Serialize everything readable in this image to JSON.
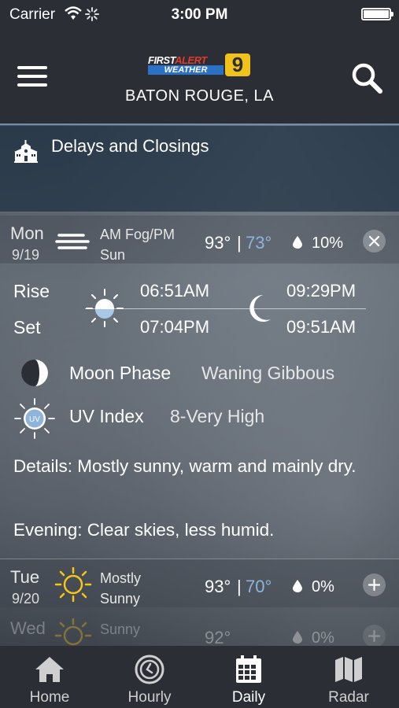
{
  "status_bar": {
    "carrier": "Carrier",
    "time": "3:00 PM"
  },
  "header": {
    "logo": {
      "first": "FIRST",
      "alert": "ALERT",
      "weather": "WEATHER",
      "channel": "9"
    },
    "location": "BATON ROUGE, LA",
    "menu_icon": "hamburger-icon",
    "search_icon": "search-icon"
  },
  "delays": {
    "icon": "school-icon",
    "label": "Delays and Closings"
  },
  "days": [
    {
      "dow": "Mon",
      "date": "9/19",
      "icon": "fog-icon",
      "condition_line1": "AM Fog/PM",
      "condition_line2": "Sun",
      "high": "93°",
      "separator": "|",
      "low": "73°",
      "precip": "10%",
      "toggle": "close-icon"
    },
    {
      "dow": "Tue",
      "date": "9/20",
      "icon": "sun-icon",
      "condition_line1": "Mostly",
      "condition_line2": "Sunny",
      "high": "93°",
      "separator": "|",
      "low": "70°",
      "precip": "0%",
      "toggle": "plus-icon"
    },
    {
      "dow": "Wed",
      "icon": "sun-icon",
      "condition_line1": "Sunny",
      "high": "92°",
      "precip": "0%",
      "toggle": "plus-icon"
    }
  ],
  "detail": {
    "rise_label": "Rise",
    "set_label": "Set",
    "sunrise": "06:51AM",
    "sunset": "07:04PM",
    "moonrise": "09:29PM",
    "moonset": "09:51AM",
    "moon_phase_label": "Moon Phase",
    "moon_phase_value": "Waning Gibbous",
    "uv_label": "UV Index",
    "uv_value": "8-Very High",
    "uv_badge": "UV",
    "details": "Details: Mostly sunny, warm and mainly dry.",
    "evening": "Evening: Clear skies, less humid."
  },
  "tabs": [
    {
      "label": "Home",
      "icon": "home-icon",
      "active": false
    },
    {
      "label": "Hourly",
      "icon": "clock-icon",
      "active": false
    },
    {
      "label": "Daily",
      "icon": "calendar-icon",
      "active": true
    },
    {
      "label": "Radar",
      "icon": "map-icon",
      "active": false
    }
  ],
  "colors": {
    "bar_bg": "#2b2f35",
    "low_temp": "#8fb4dc",
    "accent_line": "#6f8ea9",
    "sun_yellow": "#f5c518"
  }
}
